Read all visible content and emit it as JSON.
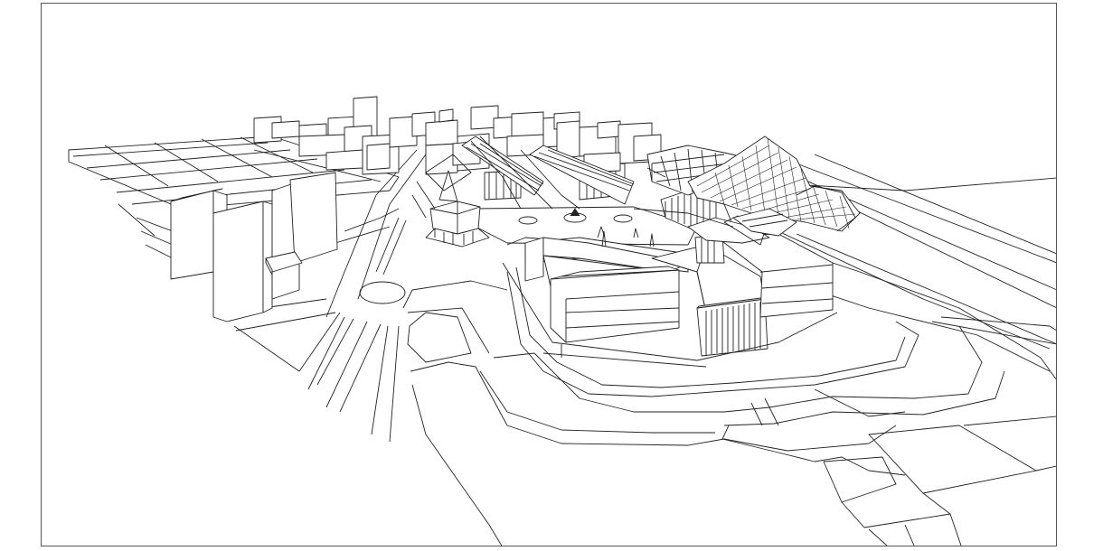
{
  "drawing": {
    "style": "line-drawing",
    "line_color": "#222222",
    "fill_color": "#ffffff",
    "frame_color": "#555555"
  }
}
